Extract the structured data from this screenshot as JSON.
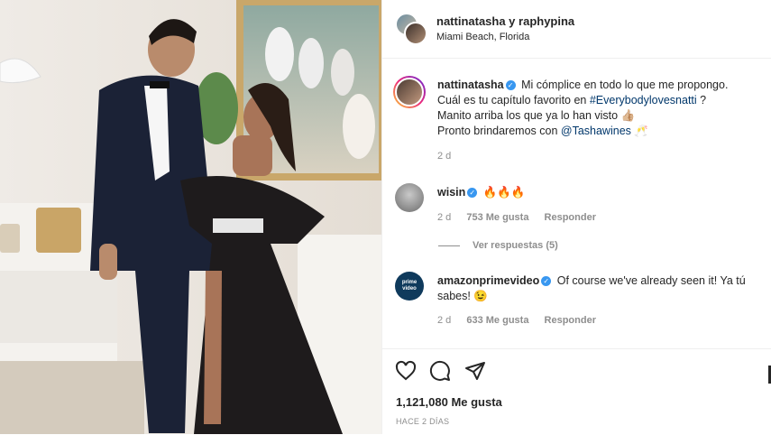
{
  "header": {
    "users": "nattinatasha y raphypina",
    "location": "Miami Beach, Florida"
  },
  "caption": {
    "user": "nattinatasha",
    "line1": "Mi cómplice en todo lo que me propongo.",
    "line2_pre": "Cuál es tu capítulo favorito en ",
    "hashtag": "#Everybodylovesnatti",
    "line2_post": " ?",
    "line3": "Manito arriba los que ya lo han visto 👍🏼",
    "line4_pre": "Pronto brindaremos con ",
    "mention": "@Tashawines",
    "line4_post": " 🥂",
    "time": "2 d"
  },
  "comments": [
    {
      "user": "wisin",
      "text": "🔥🔥🔥",
      "time": "2 d",
      "likes": "753 Me gusta",
      "reply": "Responder",
      "view_replies": "Ver respuestas (5)"
    },
    {
      "user": "amazonprimevideo",
      "avatar_text": "prime video",
      "text": "Of course we've already seen it! Ya tú sabes! 😉",
      "time": "2 d",
      "likes": "633 Me gusta",
      "reply": "Responder"
    }
  ],
  "footer": {
    "likes": "1,121,080 Me gusta",
    "ago": "HACE 2 DÍAS",
    "icons": [
      "heart-icon",
      "comment-icon",
      "share-icon",
      "bookmark-icon"
    ]
  },
  "colors": {
    "verified": "#3897f0",
    "link": "#00376b",
    "muted": "#8e8e8e"
  }
}
